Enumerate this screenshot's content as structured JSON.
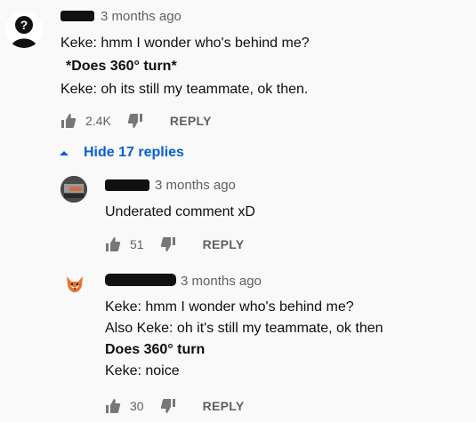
{
  "comment1": {
    "avatar_icon": "silhouette-question-icon",
    "time": "3 months ago",
    "lines": [
      "Keke: hmm I wonder who's behind me?",
      "*Does 360° turn*",
      "Keke: oh its still my teammate, ok then."
    ],
    "likes": "2.4K",
    "reply_label": "REPLY"
  },
  "replies_toggle": {
    "label": "Hide 17 replies"
  },
  "reply1": {
    "avatar_icon": "photo-avatar",
    "time": "3 months ago",
    "text": "Underated comment xD",
    "likes": "51",
    "reply_label": "REPLY"
  },
  "reply2": {
    "avatar_icon": "fox-icon",
    "time": "3 months ago",
    "lines": [
      "Keke: hmm I wonder who's behind me?",
      "Also Keke: oh it's still my teammate, ok then",
      "Does 360° turn",
      "Keke: noice"
    ],
    "likes": "30",
    "reply_label": "REPLY"
  },
  "colors": {
    "link": "#065fd4",
    "meta": "#606060",
    "redaction": "#111111"
  }
}
